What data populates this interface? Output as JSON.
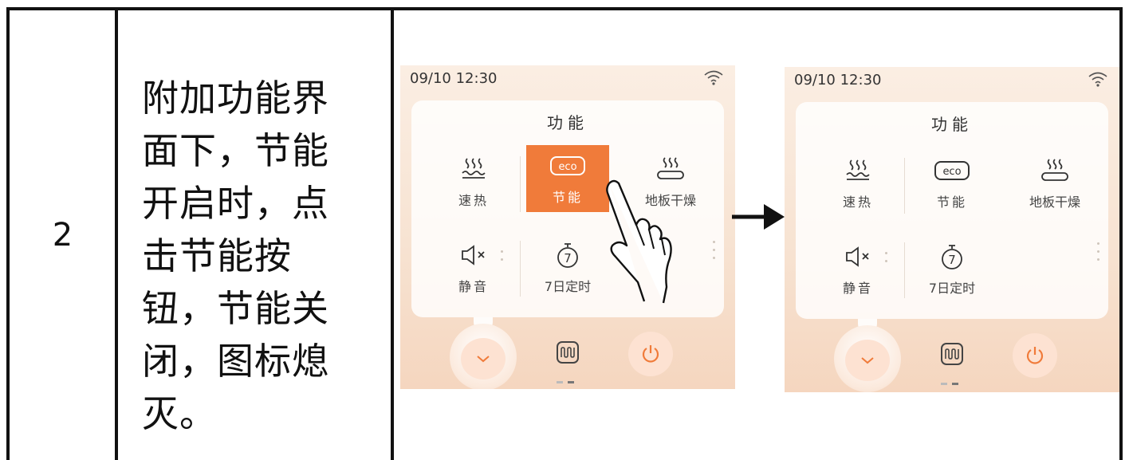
{
  "table": {
    "row_number": "2",
    "description_lines": [
      "附加功能界",
      "面下，节能",
      "开启时，点",
      "击节能按",
      "钮，节能关",
      "闭，图标熄",
      "灭。"
    ]
  },
  "screens": [
    {
      "time": "09/10  12:30",
      "panel_title": "功能",
      "items": [
        {
          "label": "速热",
          "icon": "quick-heat-icon",
          "active": false
        },
        {
          "label": "节能",
          "icon": "eco-icon",
          "icon_text": "eco",
          "active": true
        },
        {
          "label": "地板干燥",
          "icon": "floor-dry-icon",
          "active": false
        },
        {
          "label": "静音",
          "icon": "mute-icon",
          "active": false
        },
        {
          "label": "7日定时",
          "icon": "timer-7-icon",
          "icon_text": "7",
          "active": false
        }
      ]
    },
    {
      "time": "09/10  12:30",
      "panel_title": "功能",
      "items": [
        {
          "label": "速热",
          "icon": "quick-heat-icon",
          "active": false
        },
        {
          "label": "节能",
          "icon": "eco-icon",
          "icon_text": "eco",
          "active": false
        },
        {
          "label": "地板干燥",
          "icon": "floor-dry-icon",
          "active": false
        },
        {
          "label": "静音",
          "icon": "mute-icon",
          "active": false
        },
        {
          "label": "7日定时",
          "icon": "timer-7-icon",
          "icon_text": "7",
          "active": false
        }
      ]
    }
  ],
  "colors": {
    "accent": "#f07b3a",
    "power": "#f07b3a",
    "text": "#111111"
  }
}
